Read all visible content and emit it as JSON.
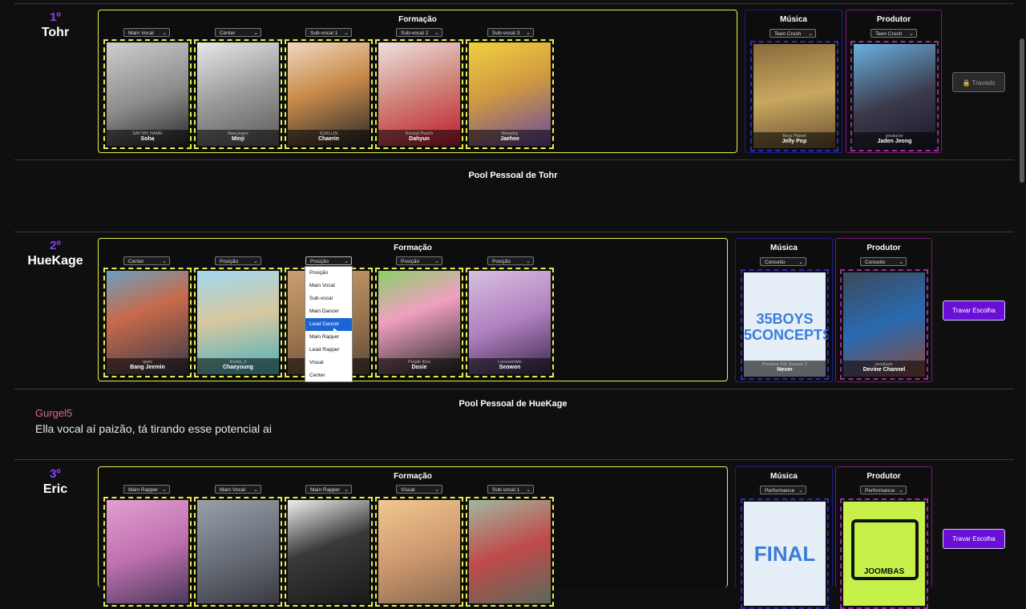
{
  "colors": {
    "accent_purple": "#8b3dff",
    "formation_border": "#e8ee4a",
    "music_border": "#2b2bbf",
    "producer_border": "#a12aa1",
    "button_purple": "#6a0fd8",
    "chat_user": "#e06a8a"
  },
  "players": [
    {
      "rank": "1º",
      "name": "Tohr",
      "formation_title": "Formação",
      "music_title": "Música",
      "producer_title": "Produtor",
      "positions": [
        "Main Vocal",
        "Center",
        "Sub-vocal 1",
        "Sub-vocal 2",
        "Sub-vocal 3"
      ],
      "members": [
        {
          "group": "SAY MY NAME",
          "name": "Soha"
        },
        {
          "group": "NewJeans",
          "name": "Minji"
        },
        {
          "group": "ICHILLIN",
          "name": "Chaerin"
        },
        {
          "group": "Rocket Punch",
          "name": "Dahyun"
        },
        {
          "group": "Weeekly",
          "name": "Jaehee"
        }
      ],
      "music_select": "Teen Crush",
      "music_sub": "Boys Planet",
      "music_name": "Jelly Pop",
      "producer_select": "Teen Crush",
      "producer_sub": "producer",
      "producer_name": "Jaden Jeong",
      "action": "Travado",
      "pool_title": "Pool  Pessoal de Tohr"
    },
    {
      "rank": "2º",
      "name": "HueKage",
      "formation_title": "Formação",
      "music_title": "Música",
      "producer_title": "Produtor",
      "positions": [
        "Center",
        "Posição",
        "Posição",
        "Posição",
        "Posição"
      ],
      "members": [
        {
          "group": "qwer",
          "name": "Bang Jeemin"
        },
        {
          "group": "fromis_9",
          "name": "Chaeyoung"
        },
        {
          "group": "",
          "name": ""
        },
        {
          "group": "Purple Kiss",
          "name": "Dosie"
        },
        {
          "group": "Loossemble",
          "name": "Seowon"
        }
      ],
      "music_select": "Conceito",
      "music_sub": "Produce 101 Season 2",
      "music_name": "Never",
      "music_art_line1": "35BOYS",
      "music_art_line2": "5CONCEPTS",
      "producer_select": "Conceito",
      "producer_sub": "producer",
      "producer_name": "Devine Channel",
      "action": "Travar Escolha",
      "pool_title": "Pool  Pessoal de HueKage"
    },
    {
      "rank": "3º",
      "name": "Eric",
      "formation_title": "Formação",
      "music_title": "Música",
      "producer_title": "Produtor",
      "positions": [
        "Main Rapper",
        "Main Vocal",
        "Main Rapper",
        "Visual",
        "Sub-vocal 1"
      ],
      "music_select": "Performance",
      "music_art": "FINAL",
      "producer_select": "Performance",
      "producer_art": "JOOMBAS",
      "action": "Travar Escolha"
    }
  ],
  "dropdown_options": [
    "Posição",
    "Main Vocal",
    "Sub-vocal",
    "Main Dancer",
    "Lead Dancer",
    "Main Rapper",
    "Lead Rapper",
    "Visual",
    "Center"
  ],
  "dropdown_highlighted": "Lead Dancer",
  "chat": {
    "user": "Gurgel5",
    "message": "Ella vocal aí paizão, tá tirando esse potencial ai"
  }
}
